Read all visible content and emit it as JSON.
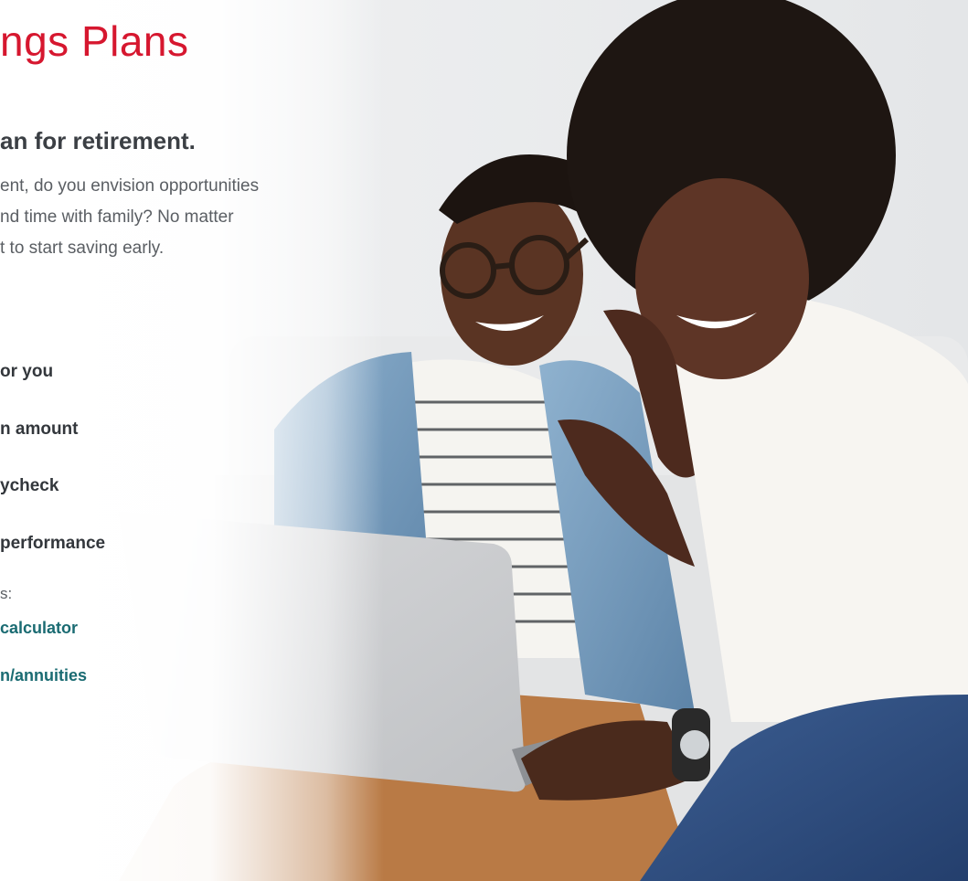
{
  "hero": {
    "title": "ngs Plans",
    "subtitle": "an for retirement.",
    "intro_lines": [
      "ent, do you envision opportunities",
      "nd time with family? No matter",
      "t to start saving early."
    ]
  },
  "features": [
    "or you",
    "n amount",
    "ycheck",
    " performance"
  ],
  "resources": {
    "label": "s:",
    "links": [
      "calculator",
      "n/annuities"
    ]
  },
  "colors": {
    "title": "#d6172f",
    "body_text": "#5a5e63",
    "feature_text": "#33373c",
    "link": "#1a6b72"
  },
  "photo": "couple-with-laptop"
}
